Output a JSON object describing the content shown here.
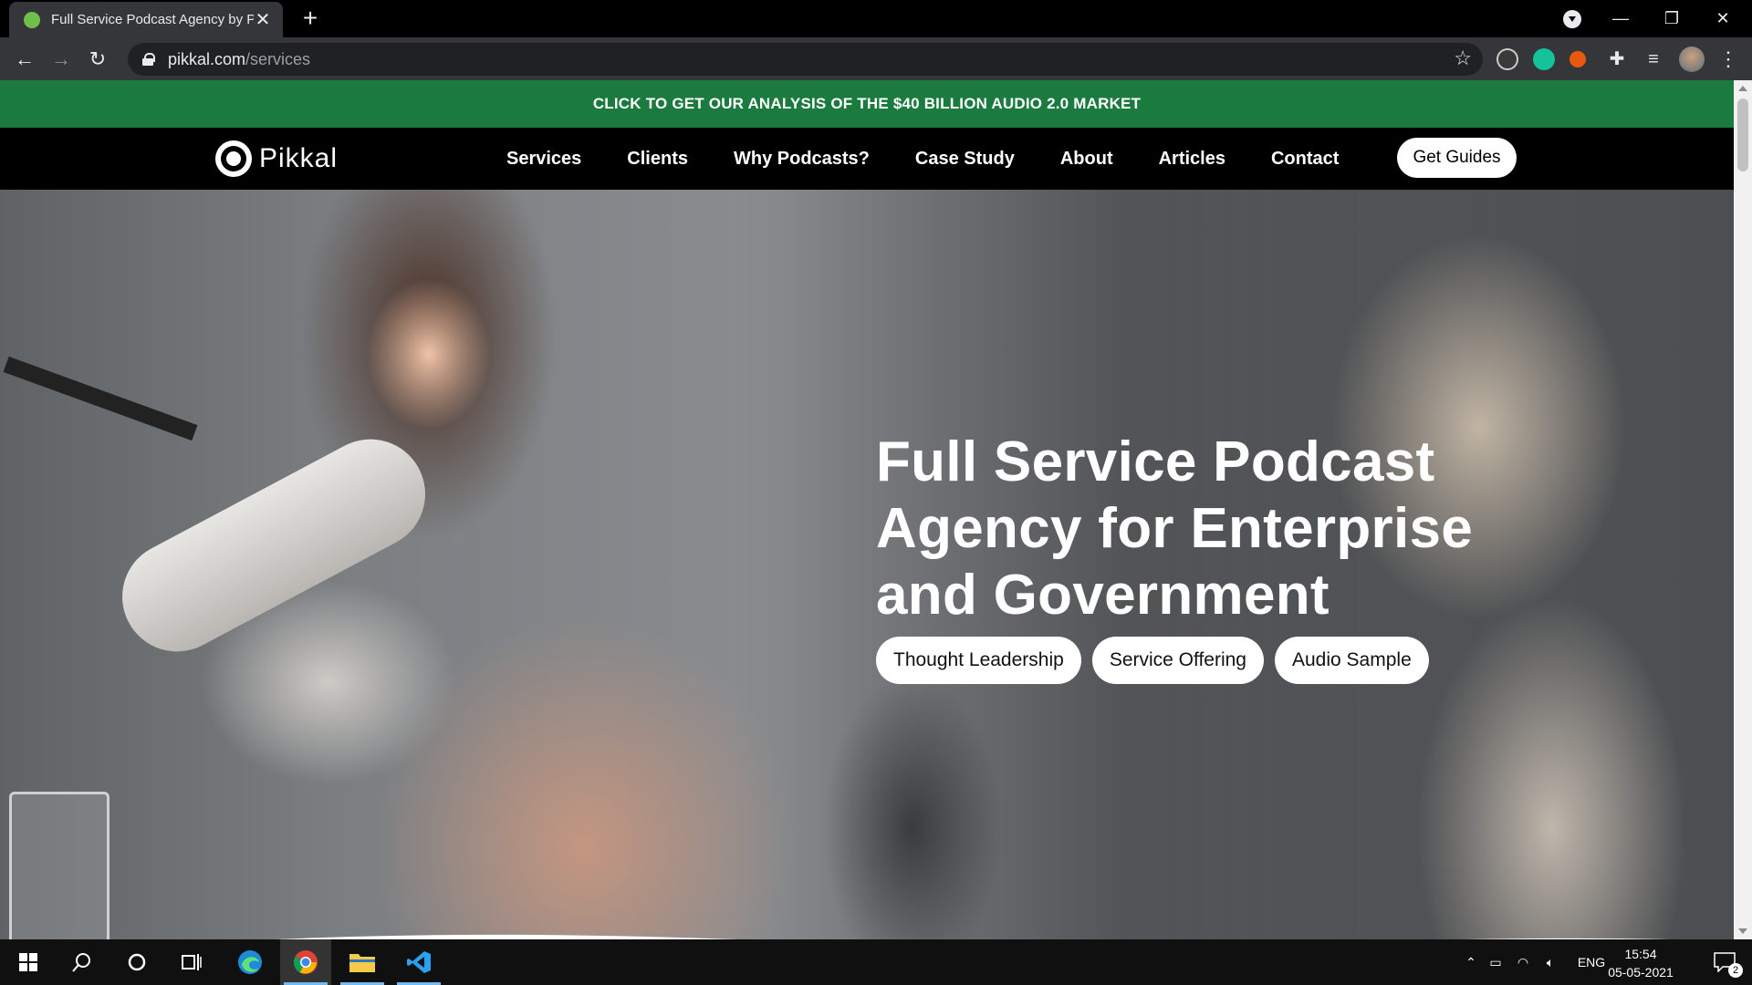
{
  "browser": {
    "tab_title": "Full Service Podcast Agency by Pi",
    "tab_close": "✕",
    "new_tab": "+",
    "url_host": "pikkal.com",
    "url_path": "/services",
    "window_controls": {
      "minimize": "—",
      "restore": "❐",
      "close": "✕"
    },
    "nav_icons": {
      "back": "←",
      "forward": "→",
      "reload": "↻",
      "bookmark": "☆",
      "extensions": "puzzle-icon",
      "menu": "⋮"
    }
  },
  "promo_banner": {
    "text": "CLICK TO GET OUR ANALYSIS OF THE $40 BILLION AUDIO 2.0 MARKET",
    "color": "#1b7a3e"
  },
  "site_nav": {
    "logo_text": "Pikkal",
    "links": [
      "Services",
      "Clients",
      "Why Podcasts?",
      "Case Study",
      "About",
      "Articles",
      "Contact"
    ],
    "cta": "Get Guides"
  },
  "hero": {
    "title_lines": [
      "Full Service Podcast",
      "Agency for Enterprise",
      "and Government"
    ],
    "buttons": [
      "Thought Leadership",
      "Service Offering",
      "Audio Sample"
    ]
  },
  "taskbar": {
    "language": "ENG",
    "time": "15:54",
    "date": "05-05-2021",
    "notification_count": "2",
    "apps": [
      "windows-start-icon",
      "search-icon",
      "cortana-icon",
      "task-view-icon",
      "edge-icon",
      "chrome-icon",
      "file-explorer-icon",
      "vscode-icon"
    ]
  }
}
